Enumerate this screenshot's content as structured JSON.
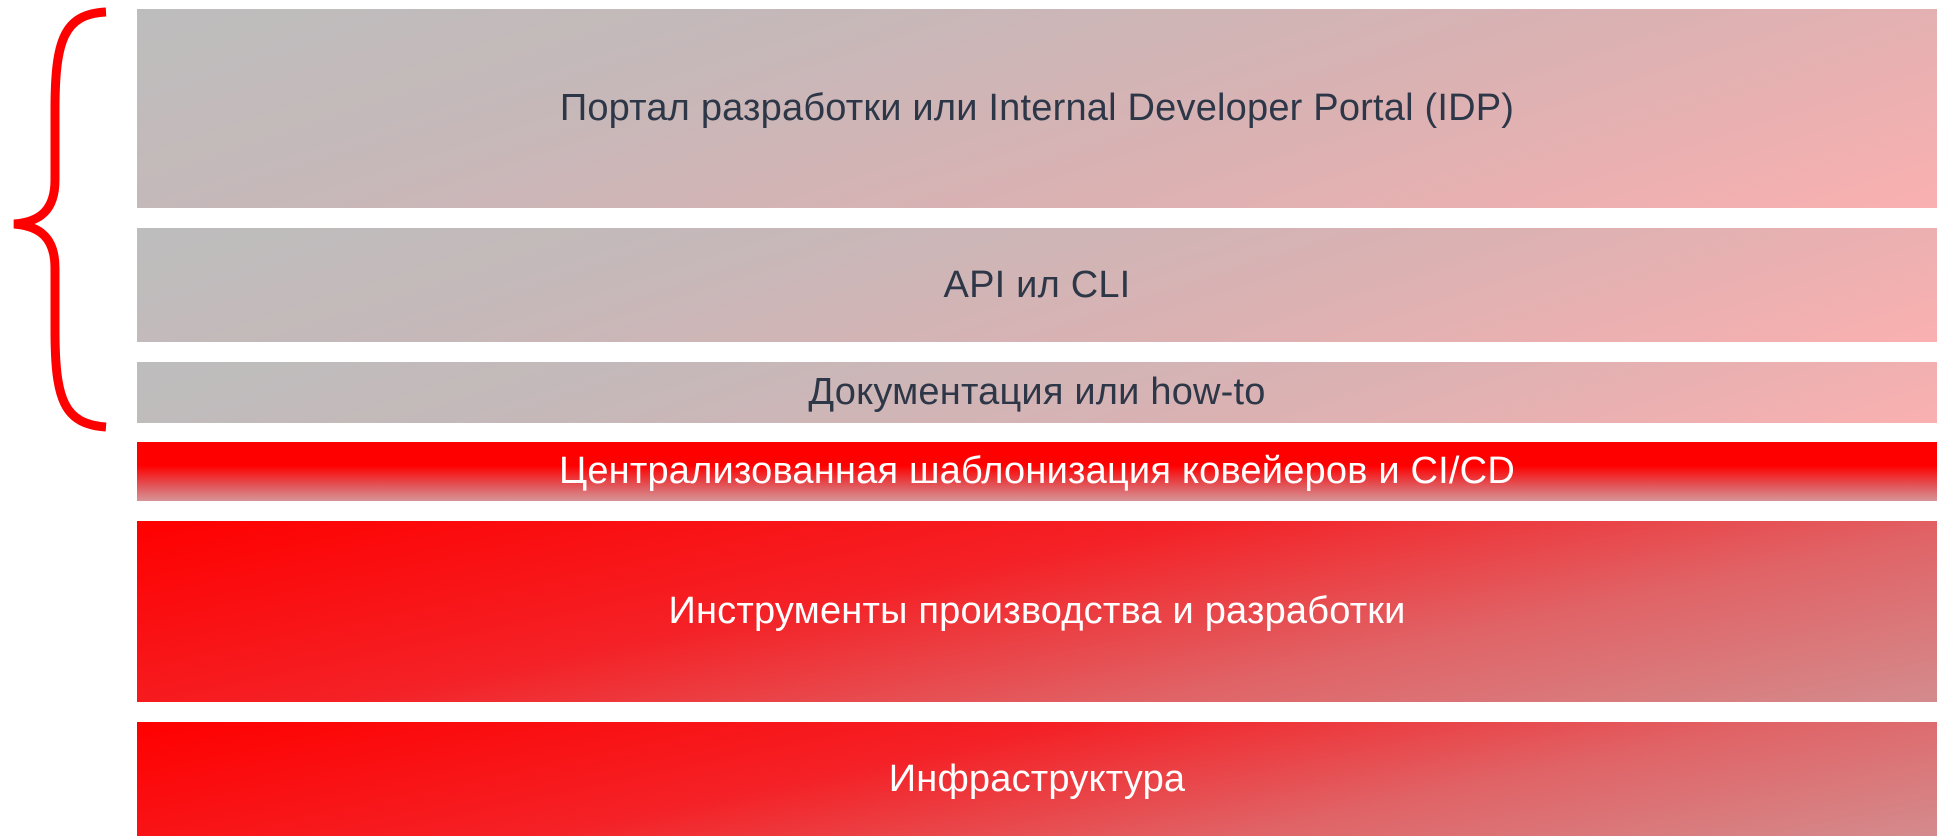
{
  "diagram": {
    "layers": [
      {
        "label": "Портал разработки или Internal Developer Portal (IDP)",
        "style": "grey"
      },
      {
        "label": "API ил CLI",
        "style": "grey"
      },
      {
        "label": "Документация или how-to",
        "style": "grey"
      },
      {
        "label": "Централизованная шаблонизация ковейеров и CI/CD",
        "style": "red"
      },
      {
        "label": "Инструменты производства и разработки",
        "style": "red"
      },
      {
        "label": "Инфраструктура",
        "style": "red"
      }
    ],
    "brace": {
      "spans_layers": [
        1,
        2,
        3
      ],
      "color": "#ff0000"
    }
  }
}
